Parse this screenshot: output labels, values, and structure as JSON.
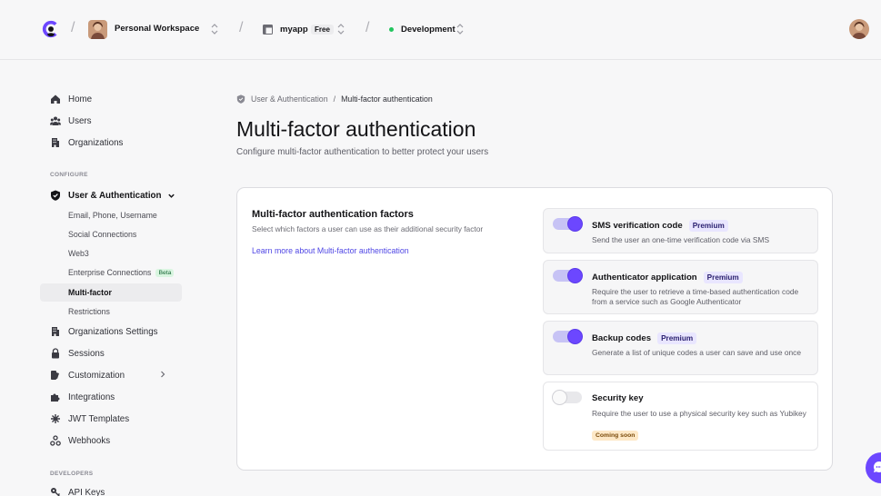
{
  "topbar": {
    "workspace_name": "Personal Workspace",
    "app_name": "myapp",
    "app_plan": "Free",
    "environment": "Development",
    "env_status_color": "#22c55e"
  },
  "sidebar": {
    "items_top": [
      {
        "label": "Home",
        "icon": "home-icon"
      },
      {
        "label": "Users",
        "icon": "users-icon"
      },
      {
        "label": "Organizations",
        "icon": "building-icon"
      }
    ],
    "section_configure": "CONFIGURE",
    "user_auth": {
      "label": "User & Authentication",
      "icon": "shield-icon"
    },
    "sub_items": [
      {
        "label": "Email, Phone, Username"
      },
      {
        "label": "Social Connections"
      },
      {
        "label": "Web3"
      },
      {
        "label": "Enterprise Connections",
        "badge": "Beta"
      },
      {
        "label": "Multi-factor",
        "active": true
      },
      {
        "label": "Restrictions"
      }
    ],
    "items_configure": [
      {
        "label": "Organizations Settings",
        "icon": "building-icon"
      },
      {
        "label": "Sessions",
        "icon": "lock-icon"
      },
      {
        "label": "Customization",
        "icon": "brush-icon"
      },
      {
        "label": "Integrations",
        "icon": "puzzle-icon"
      },
      {
        "label": "JWT Templates",
        "icon": "jwt-icon"
      },
      {
        "label": "Webhooks",
        "icon": "webhook-icon"
      }
    ],
    "section_developers": "DEVELOPERS",
    "items_developers": [
      {
        "label": "API Keys",
        "icon": "key-icon"
      }
    ]
  },
  "main": {
    "breadcrumb": {
      "parent": "User & Authentication",
      "separator": "/",
      "current": "Multi-factor authentication"
    },
    "title": "Multi-factor authentication",
    "subtitle": "Configure multi-factor authentication to better protect your users",
    "card": {
      "title": "Multi-factor authentication factors",
      "description": "Select which factors a user can use as their additional security factor",
      "link": "Learn more about Multi-factor authentication",
      "factors": [
        {
          "name": "SMS verification code",
          "badge": "Premium",
          "description": "Send the user an one-time verification code via SMS",
          "enabled": true
        },
        {
          "name": "Authenticator application",
          "badge": "Premium",
          "description": "Require the user to retrieve a time-based authentication code from a service such as Google Authenticator",
          "enabled": true
        },
        {
          "name": "Backup codes",
          "badge": "Premium",
          "description": "Generate a list of unique codes a user can save and use once",
          "enabled": true
        },
        {
          "name": "Security key",
          "badge": "Coming soon",
          "description": "Require the user to use a physical security key such as Yubikey",
          "enabled": false
        }
      ]
    }
  },
  "colors": {
    "accent": "#6c47ff",
    "link": "#4f46e5",
    "premium_bg": "#e9e6ff",
    "coming_soon_bg": "#fde8c7"
  }
}
